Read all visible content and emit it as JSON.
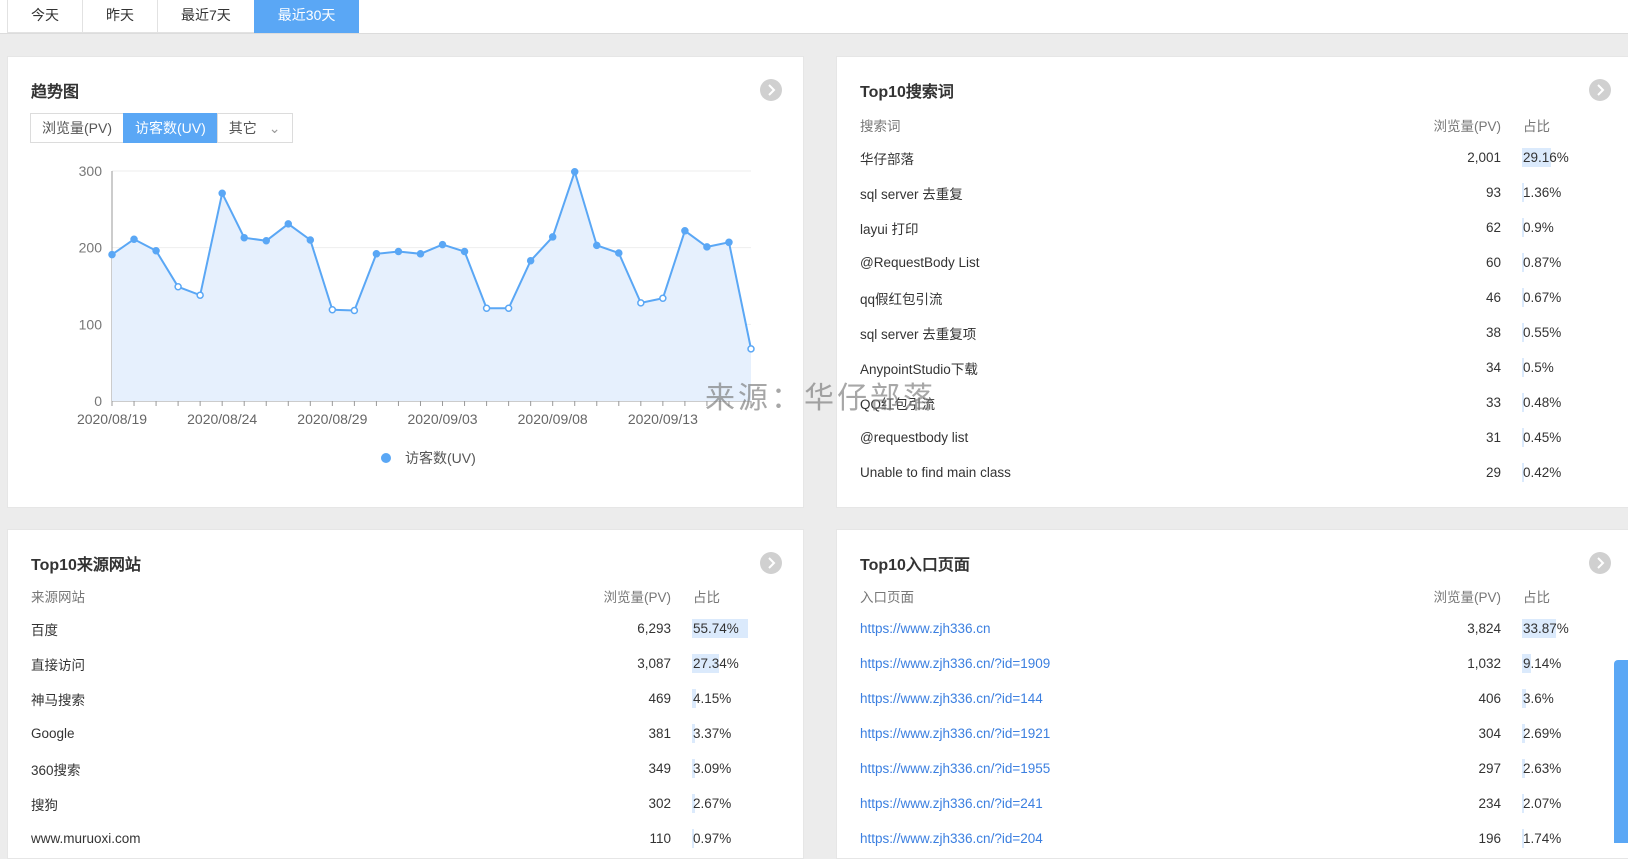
{
  "range_tabs": [
    {
      "label": "今天",
      "active": false
    },
    {
      "label": "昨天",
      "active": false
    },
    {
      "label": "最近7天",
      "active": false
    },
    {
      "label": "最近30天",
      "active": true
    }
  ],
  "trend": {
    "title": "趋势图",
    "metric_tabs": [
      "浏览量(PV)",
      "访客数(UV)",
      "其它"
    ],
    "active_metric": "访客数(UV)",
    "chevron": "chevron-down-icon"
  },
  "chart_data": {
    "type": "area",
    "series": [
      {
        "name": "访客数(UV)",
        "values": [
          191,
          211,
          196,
          149,
          138,
          271,
          213,
          209,
          231,
          210,
          119,
          118,
          192,
          195,
          192,
          204,
          195,
          121,
          121,
          183,
          214,
          299,
          203,
          193,
          128,
          134,
          222,
          201,
          207,
          68
        ]
      }
    ],
    "x_start": "2020/08/19",
    "x_tick_labels": [
      "2020/08/19",
      "2020/08/24",
      "2020/08/29",
      "2020/09/03",
      "2020/09/08",
      "2020/09/13"
    ],
    "y_ticks": [
      0,
      100,
      200,
      300
    ],
    "ylim": [
      0,
      300
    ],
    "grid": true,
    "legend_position": "bottom",
    "colors": {
      "line": "#5aa7f5",
      "fill": "#e6f0fd"
    }
  },
  "search": {
    "title": "Top10搜索词",
    "headers": [
      "搜索词",
      "浏览量(PV)",
      "占比"
    ],
    "rows": [
      {
        "term": "华仔部落",
        "pv": "2,001",
        "pct": "29.16%",
        "ratio": 0.2916
      },
      {
        "term": "sql server 去重复",
        "pv": "93",
        "pct": "1.36%",
        "ratio": 0.0136
      },
      {
        "term": "layui 打印",
        "pv": "62",
        "pct": "0.9%",
        "ratio": 0.009
      },
      {
        "term": "@RequestBody List",
        "pv": "60",
        "pct": "0.87%",
        "ratio": 0.0087
      },
      {
        "term": "qq假红包引流",
        "pv": "46",
        "pct": "0.67%",
        "ratio": 0.0067
      },
      {
        "term": "sql server 去重复项",
        "pv": "38",
        "pct": "0.55%",
        "ratio": 0.0055
      },
      {
        "term": "AnypointStudio下载",
        "pv": "34",
        "pct": "0.5%",
        "ratio": 0.005
      },
      {
        "term": "QQ红包引流",
        "pv": "33",
        "pct": "0.48%",
        "ratio": 0.0048
      },
      {
        "term": "@requestbody list",
        "pv": "31",
        "pct": "0.45%",
        "ratio": 0.0045
      },
      {
        "term": "Unable to find main class",
        "pv": "29",
        "pct": "0.42%",
        "ratio": 0.0042
      }
    ]
  },
  "sources": {
    "title": "Top10来源网站",
    "headers": [
      "来源网站",
      "浏览量(PV)",
      "占比"
    ],
    "rows": [
      {
        "site": "百度",
        "pv": "6,293",
        "pct": "55.74%",
        "ratio": 0.5574
      },
      {
        "site": "直接访问",
        "pv": "3,087",
        "pct": "27.34%",
        "ratio": 0.2734
      },
      {
        "site": "神马搜索",
        "pv": "469",
        "pct": "4.15%",
        "ratio": 0.0415
      },
      {
        "site": "Google",
        "pv": "381",
        "pct": "3.37%",
        "ratio": 0.0337
      },
      {
        "site": "360搜索",
        "pv": "349",
        "pct": "3.09%",
        "ratio": 0.0309
      },
      {
        "site": "搜狗",
        "pv": "302",
        "pct": "2.67%",
        "ratio": 0.0267
      },
      {
        "site": "www.muruoxi.com",
        "pv": "110",
        "pct": "0.97%",
        "ratio": 0.0097
      }
    ]
  },
  "entries": {
    "title": "Top10入口页面",
    "headers": [
      "入口页面",
      "浏览量(PV)",
      "占比"
    ],
    "rows": [
      {
        "url": "https://www.zjh336.cn",
        "pv": "3,824",
        "pct": "33.87%",
        "ratio": 0.3387
      },
      {
        "url": "https://www.zjh336.cn/?id=1909",
        "pv": "1,032",
        "pct": "9.14%",
        "ratio": 0.0914
      },
      {
        "url": "https://www.zjh336.cn/?id=144",
        "pv": "406",
        "pct": "3.6%",
        "ratio": 0.036
      },
      {
        "url": "https://www.zjh336.cn/?id=1921",
        "pv": "304",
        "pct": "2.69%",
        "ratio": 0.0269
      },
      {
        "url": "https://www.zjh336.cn/?id=1955",
        "pv": "297",
        "pct": "2.63%",
        "ratio": 0.0263
      },
      {
        "url": "https://www.zjh336.cn/?id=241",
        "pv": "234",
        "pct": "2.07%",
        "ratio": 0.0207
      },
      {
        "url": "https://www.zjh336.cn/?id=204",
        "pv": "196",
        "pct": "1.74%",
        "ratio": 0.0174
      }
    ]
  },
  "watermark": "来源：华仔部落",
  "icons": {
    "more": "chevron-right-circle-icon"
  }
}
